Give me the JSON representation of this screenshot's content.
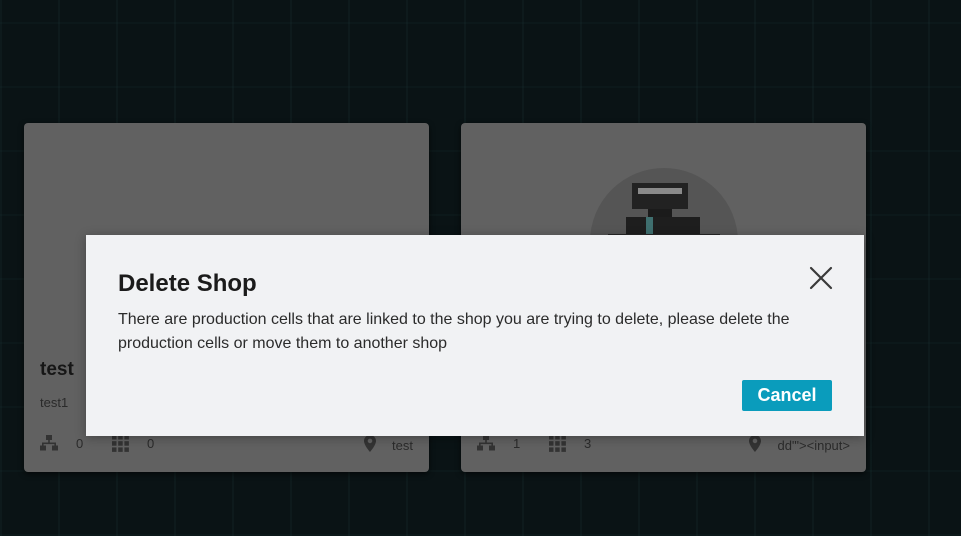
{
  "shops": [
    {
      "name": "test",
      "code": "test1",
      "hierarchy_count": "0",
      "cells_count": "0",
      "location": "test",
      "has_avatar": false
    },
    {
      "name": "",
      "code": "",
      "hierarchy_count": "1",
      "cells_count": "3",
      "location": "dd'\"><input>",
      "has_avatar": true
    }
  ],
  "modal": {
    "title": "Delete Shop",
    "message": "There are production cells that are linked to the shop you are trying to delete, please delete the production cells or move them to another shop",
    "cancel_label": "Cancel",
    "close_icon": "close-icon"
  },
  "colors": {
    "accent": "#0a9cbc",
    "card_bg": "#616161",
    "modal_bg": "#f1f2f4",
    "page_bg": "#0b1416"
  }
}
